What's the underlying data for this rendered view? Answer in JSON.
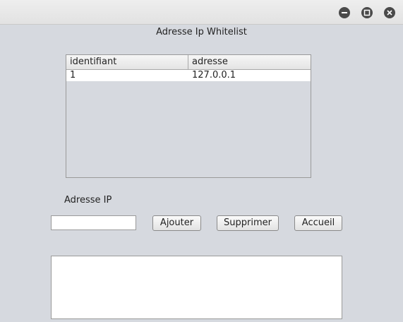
{
  "window": {
    "controls": [
      "minimize-icon",
      "maximize-icon",
      "close-icon"
    ]
  },
  "heading": "Adresse Ip Whitelist",
  "table": {
    "columns": [
      "identifiant",
      "adresse"
    ],
    "rows": [
      [
        "1",
        "127.0.0.1"
      ]
    ]
  },
  "form": {
    "ip_label": "Adresse IP",
    "ip_value": "",
    "add_label": "Ajouter",
    "delete_label": "Supprimer",
    "home_label": "Accueil"
  },
  "output": {
    "value": ""
  }
}
